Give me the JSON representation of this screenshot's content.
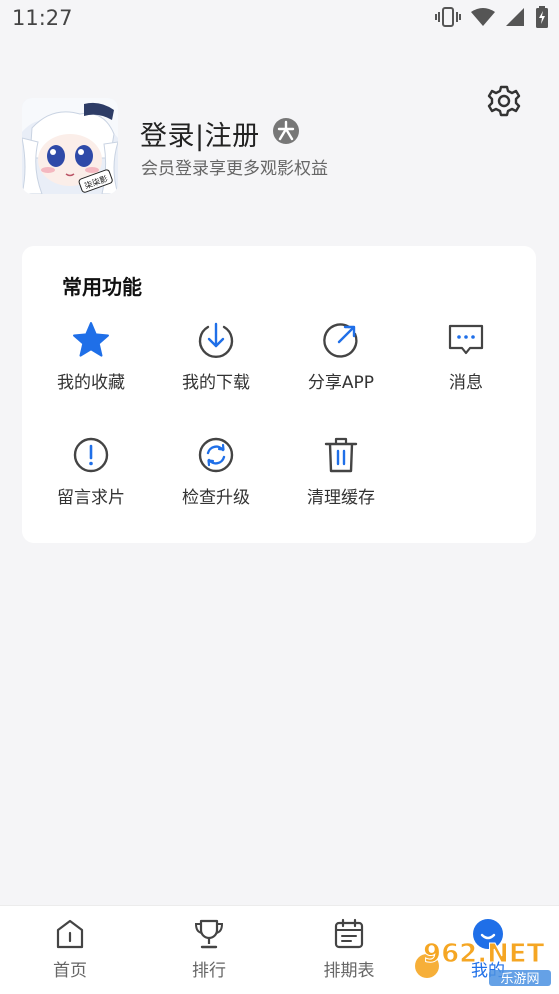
{
  "status_bar": {
    "time": "11:27"
  },
  "profile": {
    "login_label": "登录|注册",
    "subtitle": "会员登录享更多观影权益",
    "avatar_caption": "柒柒影"
  },
  "quick_functions": {
    "title": "常用功能",
    "items": [
      {
        "label": "我的收藏",
        "icon": "star-icon"
      },
      {
        "label": "我的下载",
        "icon": "download-icon"
      },
      {
        "label": "分享APP",
        "icon": "share-icon"
      },
      {
        "label": "消息",
        "icon": "message-icon"
      },
      {
        "label": "留言求片",
        "icon": "exclamation-icon"
      },
      {
        "label": "检查升级",
        "icon": "refresh-icon"
      },
      {
        "label": "清理缓存",
        "icon": "trash-icon"
      }
    ]
  },
  "tab_bar": {
    "tabs": [
      {
        "label": "首页",
        "icon": "home-icon"
      },
      {
        "label": "排行",
        "icon": "trophy-icon"
      },
      {
        "label": "排期表",
        "icon": "calendar-icon"
      },
      {
        "label": "我的",
        "icon": "profile-icon",
        "active": true
      }
    ]
  },
  "watermark": {
    "text": "962.NET",
    "subtext": "乐游网"
  },
  "colors": {
    "accent": "#1f6fe8",
    "icon_gray": "#444444",
    "card_bg": "#ffffff",
    "page_bg": "#f5f5f7"
  }
}
